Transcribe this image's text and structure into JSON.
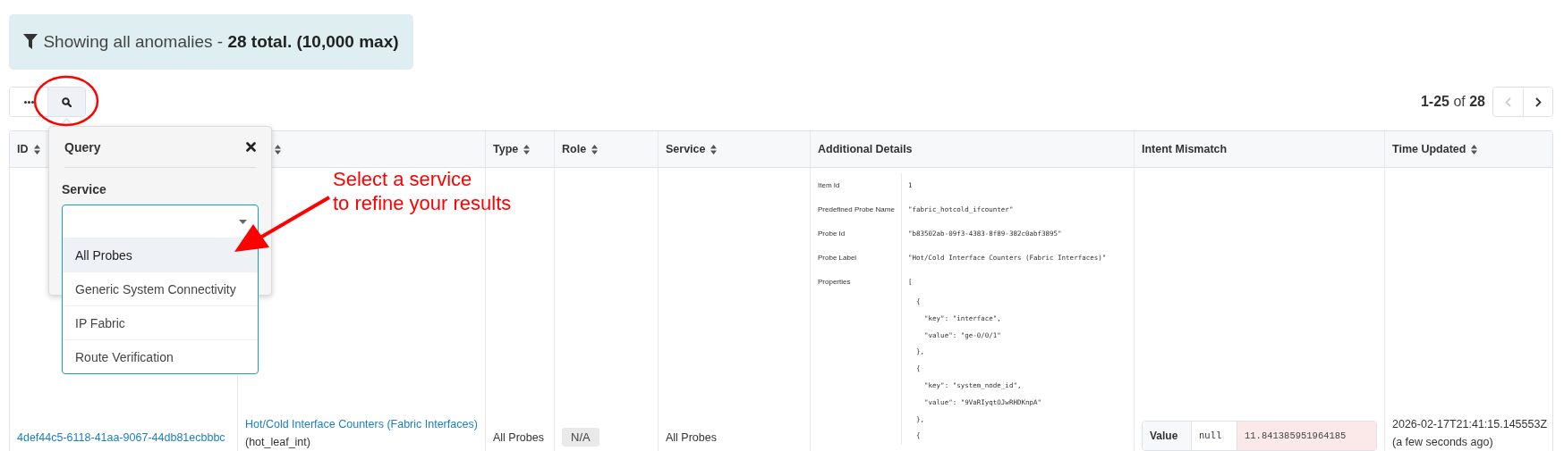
{
  "banner": {
    "text": "Showing all anomalies - **28 total. (10,000 max)**"
  },
  "pagination": {
    "range": "**1-25** of **28**",
    "prev_disabled": true,
    "next_disabled": false
  },
  "table": {
    "columns": [
      {
        "label": "ID",
        "sortable": true
      },
      {
        "sortable": true
      },
      {
        "label": "Type",
        "sortable": true
      },
      {
        "label": "Role",
        "sortable": true
      },
      {
        "label": "Service",
        "sortable": true
      },
      {
        "label": "Additional Details",
        "sortable": false
      },
      {
        "label": "Intent Mismatch",
        "sortable": false
      },
      {
        "label": "Time Updated",
        "sortable": true
      }
    ],
    "rows": [
      {
        "id": "4def44c5-6118-41aa-9067-44db81ecbbbc",
        "name": "Hot/Cold Interface Counters (Fabric Interfaces)",
        "name_sub": "(hot_leaf_int)",
        "type": "All Probes",
        "role": "N/A",
        "service": "All Probes",
        "details": [
          {
            "key": "Item Id",
            "value_lines": [
              "1"
            ]
          },
          {
            "key": "Predefined Probe Name",
            "value_lines": [
              "\"fabric_hotcold_ifcounter\""
            ]
          },
          {
            "key": "Probe Id",
            "value_lines": [
              "\"b83502ab-09f3-4383-8f89-382c0abf3895\""
            ]
          },
          {
            "key": "Probe Label",
            "value_lines": [
              "\"Hot/Cold Interface Counters (Fabric Interfaces)\""
            ]
          },
          {
            "key": "Properties",
            "value_lines": [
              "[",
              "  {",
              "    \"key\": \"interface\",",
              "    \"value\": \"ge-0/0/1\"",
              "  },",
              "  {",
              "    \"key\": \"system_node_id\",",
              "    \"value\": \"9VaRIyqtOJwRHDKnpA\"",
              "  },",
              "  {"
            ]
          }
        ],
        "intent": {
          "label": "Value",
          "expected": "null",
          "actual": "11.841385951964185"
        },
        "time": "2026-02-17T21:41:15.145553Z",
        "time_ago": "(a few seconds ago)"
      }
    ]
  },
  "query_popover": {
    "title": "Query",
    "field_label": "Service",
    "select": {
      "expanded": true,
      "options": [
        {
          "label": "All Probes",
          "highlighted": true
        },
        {
          "label": "Generic System Connectivity",
          "highlighted": false
        },
        {
          "label": "IP Fabric",
          "highlighted": false
        },
        {
          "label": "Route Verification",
          "highlighted": false
        }
      ]
    }
  },
  "annotation": {
    "text_lines": [
      "Select a service",
      "to refine your results"
    ]
  }
}
